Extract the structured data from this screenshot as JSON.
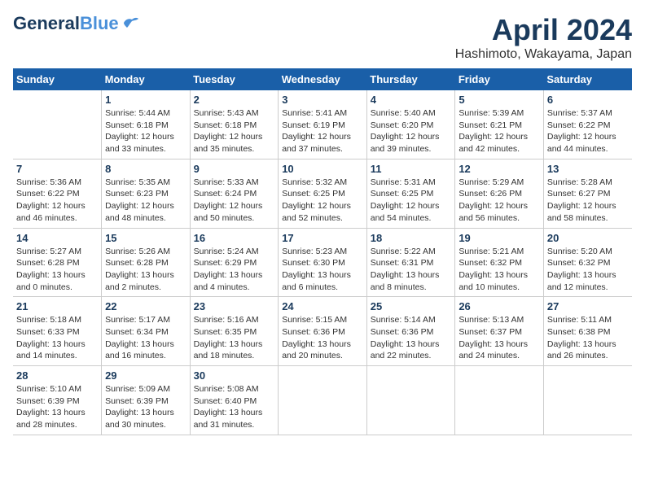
{
  "header": {
    "logo_general": "General",
    "logo_blue": "Blue",
    "title": "April 2024",
    "location": "Hashimoto, Wakayama, Japan"
  },
  "weekdays": [
    "Sunday",
    "Monday",
    "Tuesday",
    "Wednesday",
    "Thursday",
    "Friday",
    "Saturday"
  ],
  "weeks": [
    [
      {
        "day": "",
        "info": ""
      },
      {
        "day": "1",
        "info": "Sunrise: 5:44 AM\nSunset: 6:18 PM\nDaylight: 12 hours\nand 33 minutes."
      },
      {
        "day": "2",
        "info": "Sunrise: 5:43 AM\nSunset: 6:18 PM\nDaylight: 12 hours\nand 35 minutes."
      },
      {
        "day": "3",
        "info": "Sunrise: 5:41 AM\nSunset: 6:19 PM\nDaylight: 12 hours\nand 37 minutes."
      },
      {
        "day": "4",
        "info": "Sunrise: 5:40 AM\nSunset: 6:20 PM\nDaylight: 12 hours\nand 39 minutes."
      },
      {
        "day": "5",
        "info": "Sunrise: 5:39 AM\nSunset: 6:21 PM\nDaylight: 12 hours\nand 42 minutes."
      },
      {
        "day": "6",
        "info": "Sunrise: 5:37 AM\nSunset: 6:22 PM\nDaylight: 12 hours\nand 44 minutes."
      }
    ],
    [
      {
        "day": "7",
        "info": "Sunrise: 5:36 AM\nSunset: 6:22 PM\nDaylight: 12 hours\nand 46 minutes."
      },
      {
        "day": "8",
        "info": "Sunrise: 5:35 AM\nSunset: 6:23 PM\nDaylight: 12 hours\nand 48 minutes."
      },
      {
        "day": "9",
        "info": "Sunrise: 5:33 AM\nSunset: 6:24 PM\nDaylight: 12 hours\nand 50 minutes."
      },
      {
        "day": "10",
        "info": "Sunrise: 5:32 AM\nSunset: 6:25 PM\nDaylight: 12 hours\nand 52 minutes."
      },
      {
        "day": "11",
        "info": "Sunrise: 5:31 AM\nSunset: 6:25 PM\nDaylight: 12 hours\nand 54 minutes."
      },
      {
        "day": "12",
        "info": "Sunrise: 5:29 AM\nSunset: 6:26 PM\nDaylight: 12 hours\nand 56 minutes."
      },
      {
        "day": "13",
        "info": "Sunrise: 5:28 AM\nSunset: 6:27 PM\nDaylight: 12 hours\nand 58 minutes."
      }
    ],
    [
      {
        "day": "14",
        "info": "Sunrise: 5:27 AM\nSunset: 6:28 PM\nDaylight: 13 hours\nand 0 minutes."
      },
      {
        "day": "15",
        "info": "Sunrise: 5:26 AM\nSunset: 6:28 PM\nDaylight: 13 hours\nand 2 minutes."
      },
      {
        "day": "16",
        "info": "Sunrise: 5:24 AM\nSunset: 6:29 PM\nDaylight: 13 hours\nand 4 minutes."
      },
      {
        "day": "17",
        "info": "Sunrise: 5:23 AM\nSunset: 6:30 PM\nDaylight: 13 hours\nand 6 minutes."
      },
      {
        "day": "18",
        "info": "Sunrise: 5:22 AM\nSunset: 6:31 PM\nDaylight: 13 hours\nand 8 minutes."
      },
      {
        "day": "19",
        "info": "Sunrise: 5:21 AM\nSunset: 6:32 PM\nDaylight: 13 hours\nand 10 minutes."
      },
      {
        "day": "20",
        "info": "Sunrise: 5:20 AM\nSunset: 6:32 PM\nDaylight: 13 hours\nand 12 minutes."
      }
    ],
    [
      {
        "day": "21",
        "info": "Sunrise: 5:18 AM\nSunset: 6:33 PM\nDaylight: 13 hours\nand 14 minutes."
      },
      {
        "day": "22",
        "info": "Sunrise: 5:17 AM\nSunset: 6:34 PM\nDaylight: 13 hours\nand 16 minutes."
      },
      {
        "day": "23",
        "info": "Sunrise: 5:16 AM\nSunset: 6:35 PM\nDaylight: 13 hours\nand 18 minutes."
      },
      {
        "day": "24",
        "info": "Sunrise: 5:15 AM\nSunset: 6:36 PM\nDaylight: 13 hours\nand 20 minutes."
      },
      {
        "day": "25",
        "info": "Sunrise: 5:14 AM\nSunset: 6:36 PM\nDaylight: 13 hours\nand 22 minutes."
      },
      {
        "day": "26",
        "info": "Sunrise: 5:13 AM\nSunset: 6:37 PM\nDaylight: 13 hours\nand 24 minutes."
      },
      {
        "day": "27",
        "info": "Sunrise: 5:11 AM\nSunset: 6:38 PM\nDaylight: 13 hours\nand 26 minutes."
      }
    ],
    [
      {
        "day": "28",
        "info": "Sunrise: 5:10 AM\nSunset: 6:39 PM\nDaylight: 13 hours\nand 28 minutes."
      },
      {
        "day": "29",
        "info": "Sunrise: 5:09 AM\nSunset: 6:39 PM\nDaylight: 13 hours\nand 30 minutes."
      },
      {
        "day": "30",
        "info": "Sunrise: 5:08 AM\nSunset: 6:40 PM\nDaylight: 13 hours\nand 31 minutes."
      },
      {
        "day": "",
        "info": ""
      },
      {
        "day": "",
        "info": ""
      },
      {
        "day": "",
        "info": ""
      },
      {
        "day": "",
        "info": ""
      }
    ]
  ]
}
